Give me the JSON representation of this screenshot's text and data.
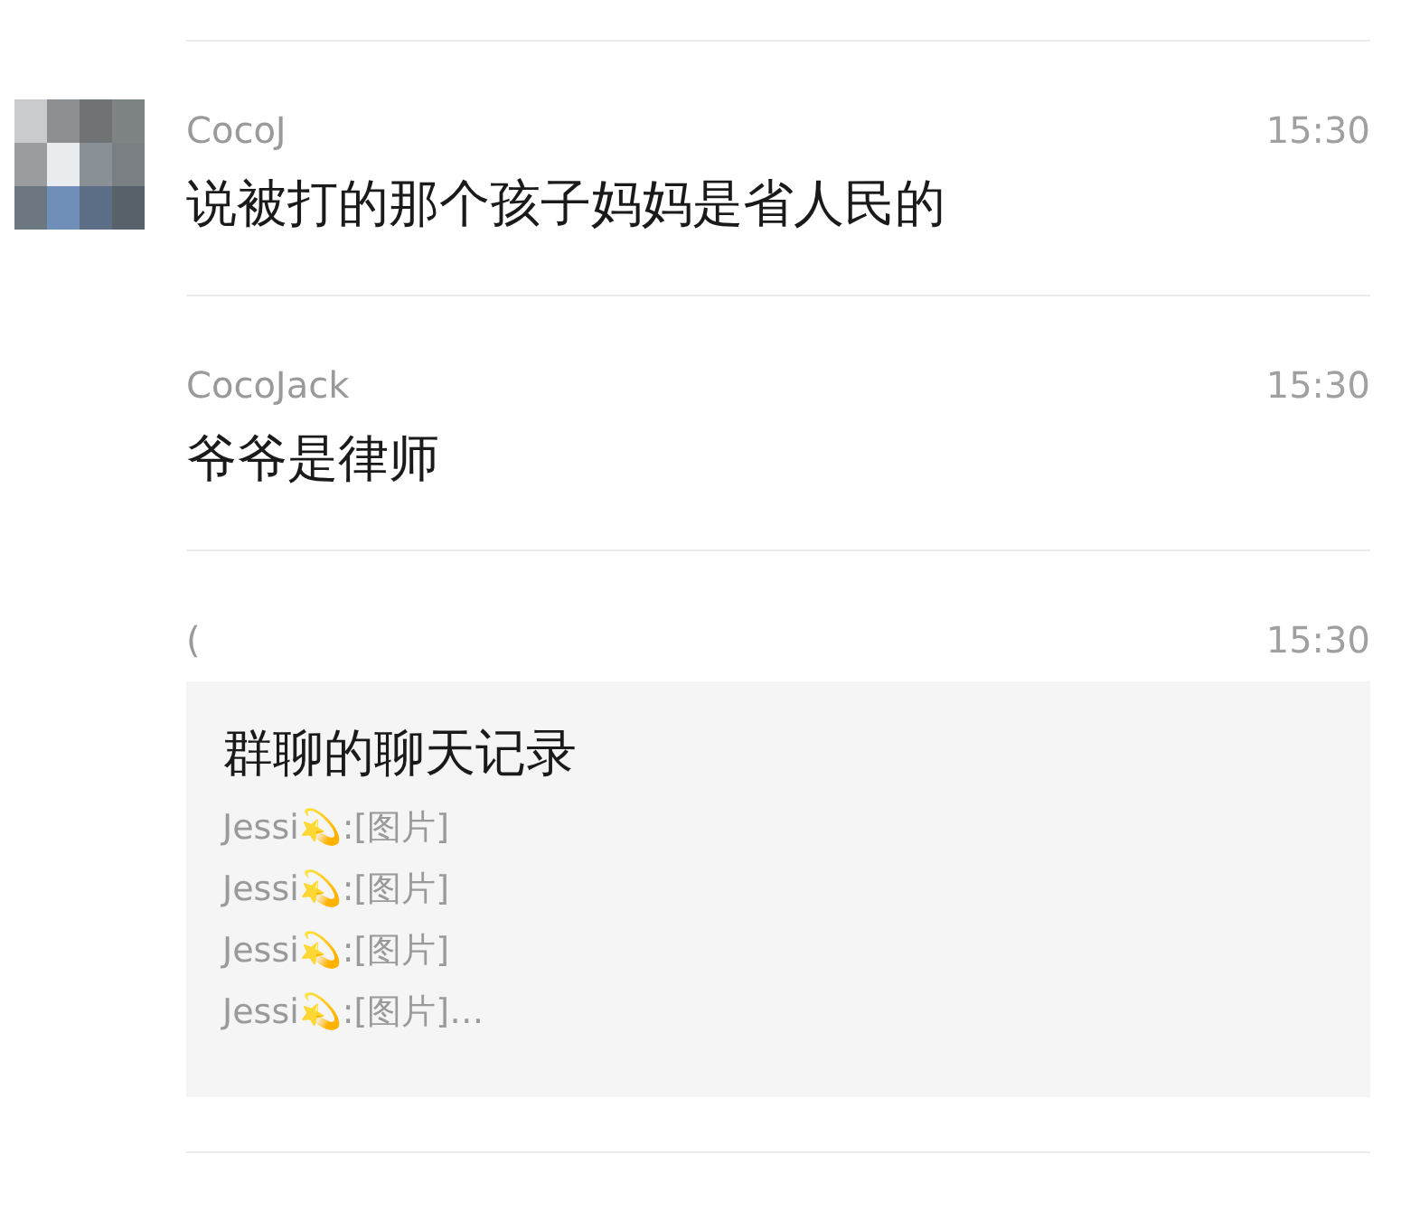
{
  "messages": [
    {
      "kind": "text",
      "sender": "CocoJ",
      "time": "15:30",
      "text": "说被打的那个孩子妈妈是省人民的"
    },
    {
      "kind": "text",
      "sender": "CocoJack",
      "time": "15:30",
      "text": "爷爷是律师"
    },
    {
      "kind": "record",
      "sender": "(",
      "time": "15:30",
      "title": "群聊的聊天记录",
      "lines": [
        "Jessi💫:[图片]",
        "Jessi💫:[图片]",
        "Jessi💫:[图片]",
        "Jessi💫:[图片]…"
      ]
    }
  ]
}
